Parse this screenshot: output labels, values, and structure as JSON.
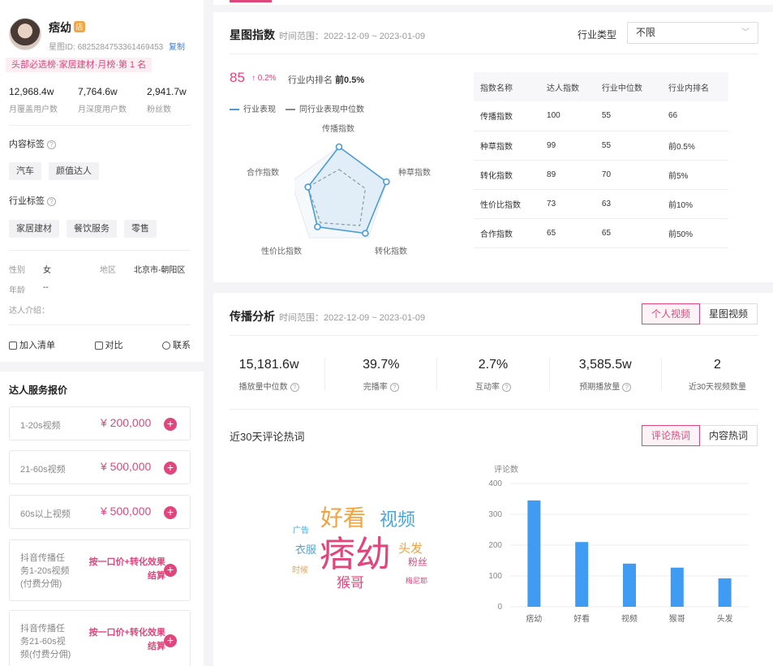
{
  "profile": {
    "name": "痞幼",
    "shop_badge": "店",
    "id_label": "星图ID:",
    "id_value": "6825284753361469453",
    "copy_label": "复制",
    "rank_text": "头部必选榜·家居建材·月榜·第 1 名",
    "stats": [
      {
        "value": "12,968.4w",
        "label": "月覆盖用户数"
      },
      {
        "value": "7,764.6w",
        "label": "月深度用户数"
      },
      {
        "value": "2,941.7w",
        "label": "粉丝数"
      }
    ],
    "content_tags_title": "内容标签",
    "content_tags": [
      "汽车",
      "颜值达人"
    ],
    "industry_tags_title": "行业标签",
    "industry_tags": [
      "家居建材",
      "餐饮服务",
      "零售"
    ],
    "gender_key": "性别",
    "gender_val": "女",
    "region_key": "地区",
    "region_val": "北京市-朝阳区",
    "age_key": "年龄",
    "age_val": "--",
    "intro_key": "达人介绍：",
    "actions": {
      "add": "加入清单",
      "compare": "对比",
      "contact": "联系"
    }
  },
  "pricing": {
    "title": "达人服务报价",
    "items": [
      {
        "label": "1-20s视频",
        "price": "¥ 200,000"
      },
      {
        "label": "21-60s视频",
        "price": "¥ 500,000"
      },
      {
        "label": "60s以上视频",
        "price": "¥ 500,000"
      },
      {
        "label_lines": [
          "抖音传播任",
          "务1-20s视频",
          "(付费分佣)"
        ],
        "price_lines": [
          "按一口价+转化效果",
          "结算"
        ]
      },
      {
        "label_lines": [
          "抖音传播任",
          "务21-60s视",
          "频(付费分佣)"
        ],
        "price_lines": [
          "按一口价+转化效果",
          "结算"
        ]
      }
    ]
  },
  "star_index": {
    "title": "星图指数",
    "range": "时间范围：2022-12-09 ~ 2023-01-09",
    "industry_label": "行业类型",
    "industry_value": "不限",
    "score": "85",
    "change": "↑ 0.2%",
    "rank_prefix": "行业内排名",
    "rank_value": "前0.5%",
    "legend": [
      "行业表现",
      "同行业表现中位数"
    ],
    "radar_labels": [
      "传播指数",
      "种草指数",
      "转化指数",
      "性价比指数",
      "合作指数"
    ],
    "radar_values": [
      100,
      99,
      89,
      73,
      65
    ],
    "radar_median": [
      55,
      55,
      70,
      63,
      65
    ],
    "table": {
      "headers": [
        "指数名称",
        "达人指数",
        "行业中位数",
        "行业内排名"
      ],
      "rows": [
        [
          "传播指数",
          "100",
          "55",
          "66"
        ],
        [
          "种草指数",
          "99",
          "55",
          "前0.5%"
        ],
        [
          "转化指数",
          "89",
          "70",
          "前5%"
        ],
        [
          "性价比指数",
          "73",
          "63",
          "前10%"
        ],
        [
          "合作指数",
          "65",
          "65",
          "前50%"
        ]
      ]
    }
  },
  "spread": {
    "title": "传播分析",
    "range": "时间范围：2022-12-09 ~ 2023-01-09",
    "tabs": [
      "个人视频",
      "星图视频"
    ],
    "metrics": [
      {
        "value": "15,181.6w",
        "label": "播放量中位数"
      },
      {
        "value": "39.7%",
        "label": "完播率"
      },
      {
        "value": "2.7%",
        "label": "互动率"
      },
      {
        "value": "3,585.5w",
        "label": "预期播放量"
      },
      {
        "value": "2",
        "label": "近30天视频数量"
      }
    ],
    "comments_title": "近30天评论热词",
    "comment_tabs": [
      "评论热词",
      "内容热词"
    ],
    "words": [
      "好看",
      "视频",
      "广告",
      "衣服",
      "痞幼",
      "头发",
      "粉丝",
      "时候",
      "猴哥",
      "梅尼耶"
    ]
  },
  "chart_data": {
    "type": "bar",
    "ylabel": "评论数",
    "categories": [
      "痞幼",
      "好看",
      "视频",
      "猴哥",
      "头发"
    ],
    "values": [
      345,
      210,
      140,
      127,
      92
    ],
    "ylim": [
      0,
      400
    ],
    "yticks": [
      "0",
      "100",
      "200",
      "300",
      "400"
    ],
    "bar_color": "#3f9cf2"
  },
  "colors": {
    "accent": "#e0467c",
    "radar": "#4a9cd6"
  }
}
